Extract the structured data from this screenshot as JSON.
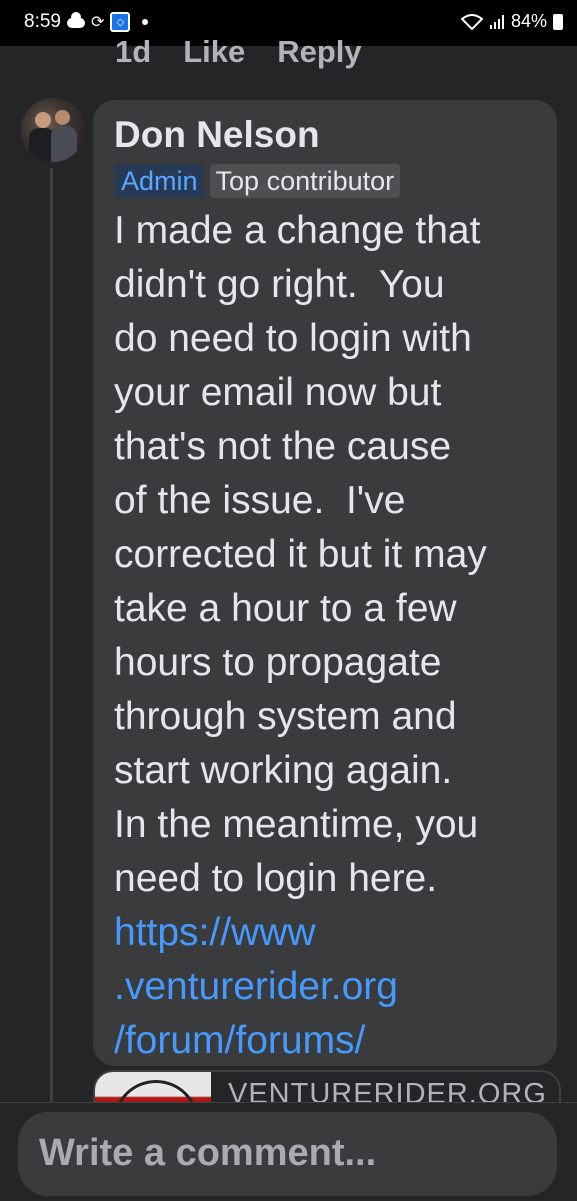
{
  "status_bar": {
    "time": "8:59",
    "battery": "84%",
    "icons": [
      "cloud-icon",
      "sync-icon",
      "app-icon",
      "notification-dot-icon",
      "wifi-icon",
      "signal-icon",
      "battery-icon"
    ]
  },
  "previous_comment_actions": {
    "time": "1d",
    "like": "Like",
    "reply": "Reply"
  },
  "comment": {
    "author": "Don Nelson",
    "badges": {
      "admin": "Admin",
      "top": "Top contributor"
    },
    "lines": [
      "I made a change that",
      "didn't go right.  You",
      "do need to login with",
      "your email now but",
      "that's not the cause",
      "of the issue.  I've",
      "corrected it but it may",
      "take a hour to a few",
      "hours to propagate",
      "through system and",
      "start working again.",
      "In the meantime, you",
      "need to login here."
    ],
    "link_lines": [
      "https://www",
      ".venturerider.org",
      "/forum/forums/"
    ]
  },
  "link_preview": {
    "domain": "VENTURERIDER.ORG"
  },
  "composer": {
    "placeholder": "Write a comment..."
  },
  "colors": {
    "background": "#242526",
    "bubble": "#3a3b3c",
    "link": "#4599ff",
    "admin_badge_text": "#5aa7ff"
  }
}
